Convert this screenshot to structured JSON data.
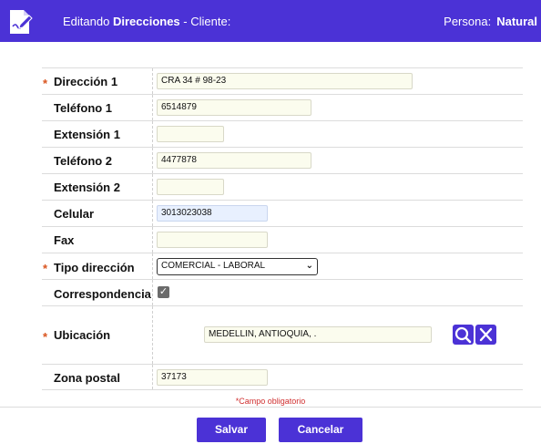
{
  "header": {
    "prefix": "Editando",
    "entity": "Direcciones",
    "suffix": "- Cliente:",
    "persona_label": "Persona:",
    "persona_value": "Natural"
  },
  "fields": {
    "direccion1": {
      "label": "Dirección 1",
      "value": "CRA 34 # 98-23",
      "required": true
    },
    "telefono1": {
      "label": "Teléfono 1",
      "value": "6514879"
    },
    "extension1": {
      "label": "Extensión 1",
      "value": ""
    },
    "telefono2": {
      "label": "Teléfono 2",
      "value": "4477878"
    },
    "extension2": {
      "label": "Extensión 2",
      "value": ""
    },
    "celular": {
      "label": "Celular",
      "value": "3013023038"
    },
    "fax": {
      "label": "Fax",
      "value": ""
    },
    "tipo_direccion": {
      "label": "Tipo dirección",
      "value": "COMERCIAL - LABORAL",
      "required": true
    },
    "correspondencia": {
      "label": "Correspondencia",
      "checked": true
    },
    "ubicacion": {
      "label": "Ubicación",
      "value": "MEDELLIN, ANTIOQUIA, .",
      "required": true
    },
    "zona_postal": {
      "label": "Zona postal",
      "value": "37173"
    }
  },
  "required_marker": "*",
  "footer": {
    "note": "*Campo obligatorio",
    "save_label": "Salvar",
    "cancel_label": "Cancelar"
  },
  "icons": {
    "logo": "edit-document-icon",
    "search": "magnifier-icon",
    "clear": "close-x-icon",
    "checkbox": "checkmark-icon",
    "select": "chevron-down-icon"
  },
  "colors": {
    "accent": "#4b32d6",
    "required": "#d9541e",
    "input_bg": "#fbfcee",
    "autofill_bg": "#e8f0fe"
  }
}
